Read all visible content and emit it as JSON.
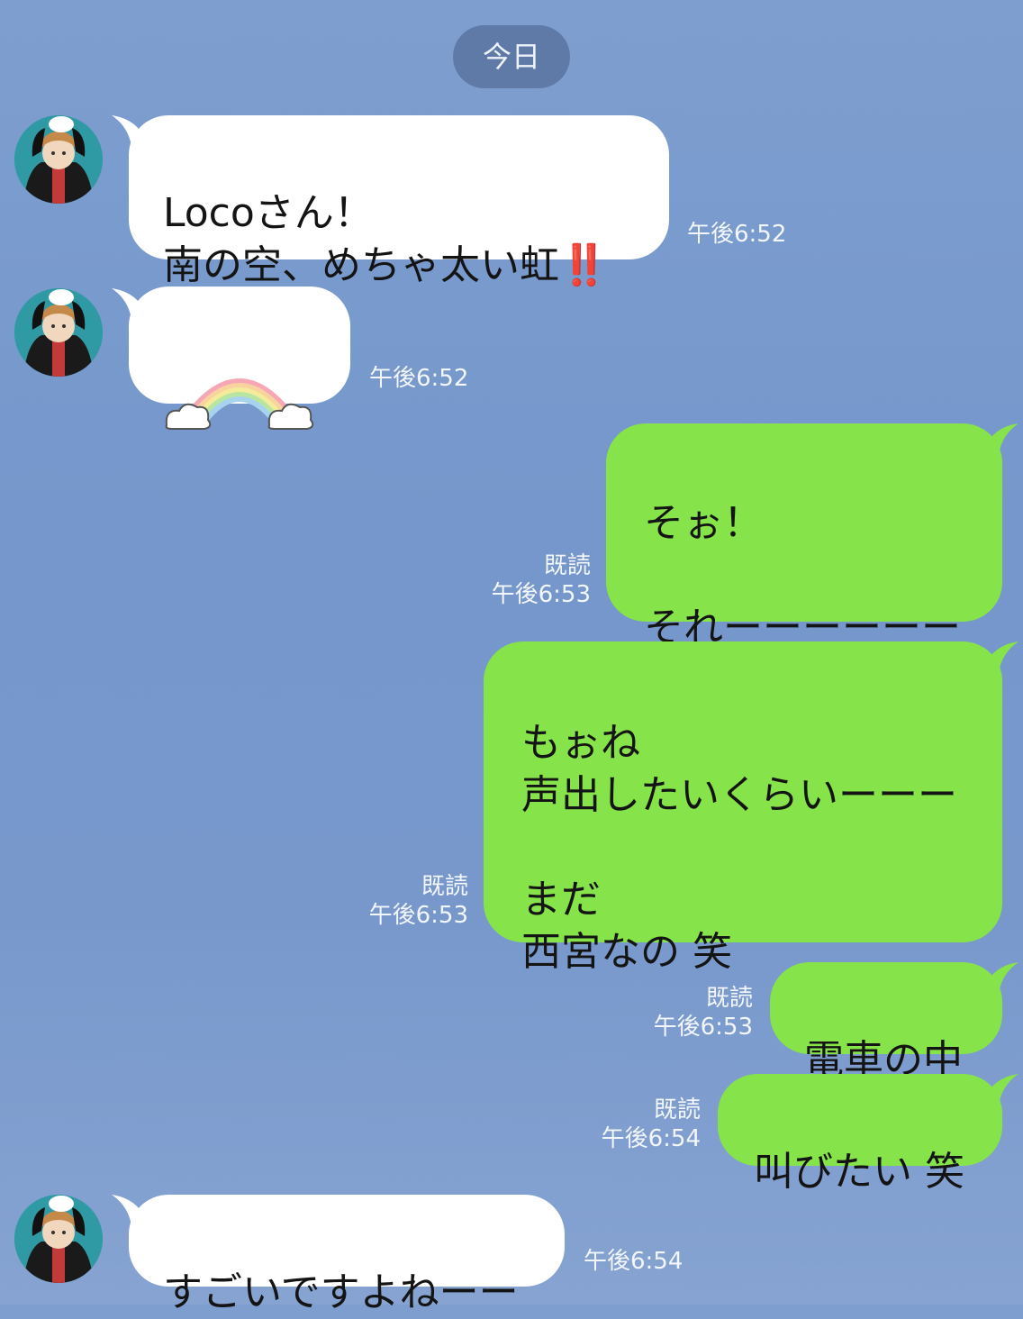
{
  "date_label": "今日",
  "messages": [
    {
      "sender": "incoming",
      "text": "Locoさん！\n南の空、めちゃ太い虹",
      "emoji": "‼️",
      "time": "午後6:52"
    },
    {
      "sender": "incoming",
      "sticker": "rainbow-sticker",
      "time": "午後6:52"
    },
    {
      "sender": "outgoing",
      "text": "そぉ！\n\nそれーーーーーー",
      "read": "既読",
      "time": "午後6:53"
    },
    {
      "sender": "outgoing",
      "text": "もぉね\n声出したいくらいーーー\n\nまだ\n西宮なの 笑",
      "read": "既読",
      "time": "午後6:53"
    },
    {
      "sender": "outgoing",
      "text": "電車の中",
      "read": "既読",
      "time": "午後6:53"
    },
    {
      "sender": "outgoing",
      "text": "叫びたい 笑",
      "read": "既読",
      "time": "午後6:54"
    },
    {
      "sender": "incoming",
      "text": "すごいですよねーー",
      "time": "午後6:54"
    }
  ],
  "colors": {
    "incoming_bubble": "#ffffff",
    "outgoing_bubble": "#86e44a",
    "background": "#7597cb"
  },
  "icons": {
    "avatar": "user-avatar-icon",
    "emoji": "double-exclamation-icon",
    "sticker": "rainbow-icon"
  }
}
